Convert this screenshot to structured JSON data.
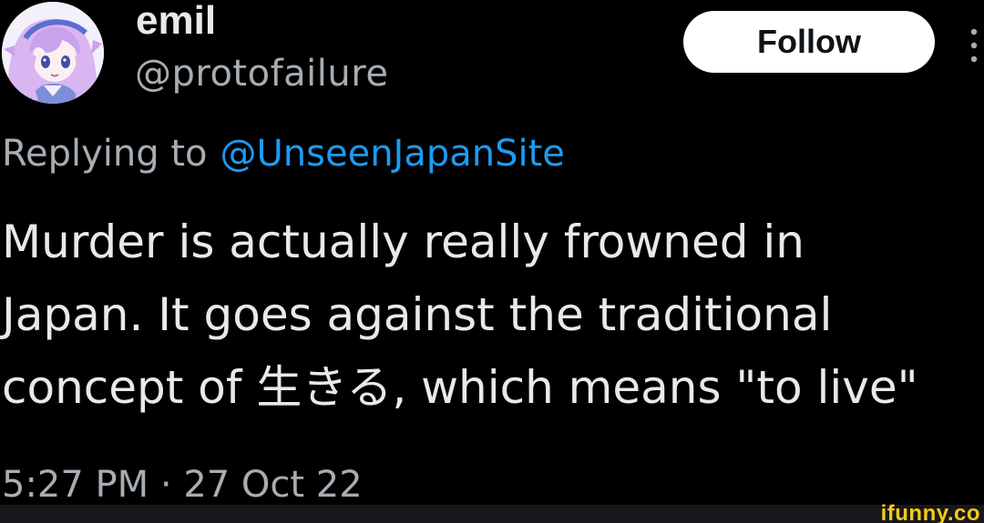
{
  "tweet": {
    "display_name": "emil",
    "handle": "@protofailure",
    "follow_label": "Follow",
    "replying_to_prefix": "Replying to",
    "replying_to_handle": "@UnseenJapanSite",
    "text_lines": [
      "Murder is actually really frowned in",
      "Japan. It goes against the traditional",
      "concept of 生きる, which means \"to live\""
    ],
    "timestamp": "5:27 PM · 27 Oct 22"
  },
  "watermark": {
    "text": "ifunny.co"
  },
  "icons": {
    "avatar": "avatar-anime-character",
    "more": "more-options-icon"
  },
  "colors": {
    "background": "#000000",
    "primary_text": "#e7e9ea",
    "secondary_text": "#a7adb2",
    "link": "#1d9bf0",
    "follow_button_bg": "#ffffff",
    "watermark": "#f6c91a"
  }
}
